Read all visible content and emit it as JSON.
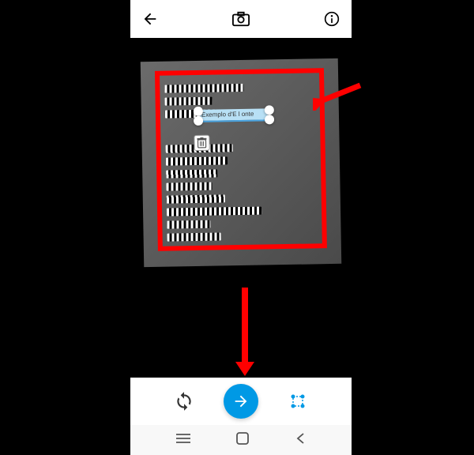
{
  "topbar": {
    "back": "back-icon",
    "camera": "camera-icon",
    "info": "info-icon"
  },
  "selection": {
    "text": "Exemplo d'E l onte",
    "trash": "trash-icon"
  },
  "bottombar": {
    "rotate": "rotate-icon",
    "next": "arrow-right-icon",
    "crop": "crop-handles-icon"
  },
  "nav": {
    "recents": "recents-icon",
    "home": "home-icon",
    "back": "back-icon"
  },
  "annotations": {
    "highlight_box": "red",
    "arrow1_target": "selected-text",
    "arrow2_target": "next-button"
  }
}
